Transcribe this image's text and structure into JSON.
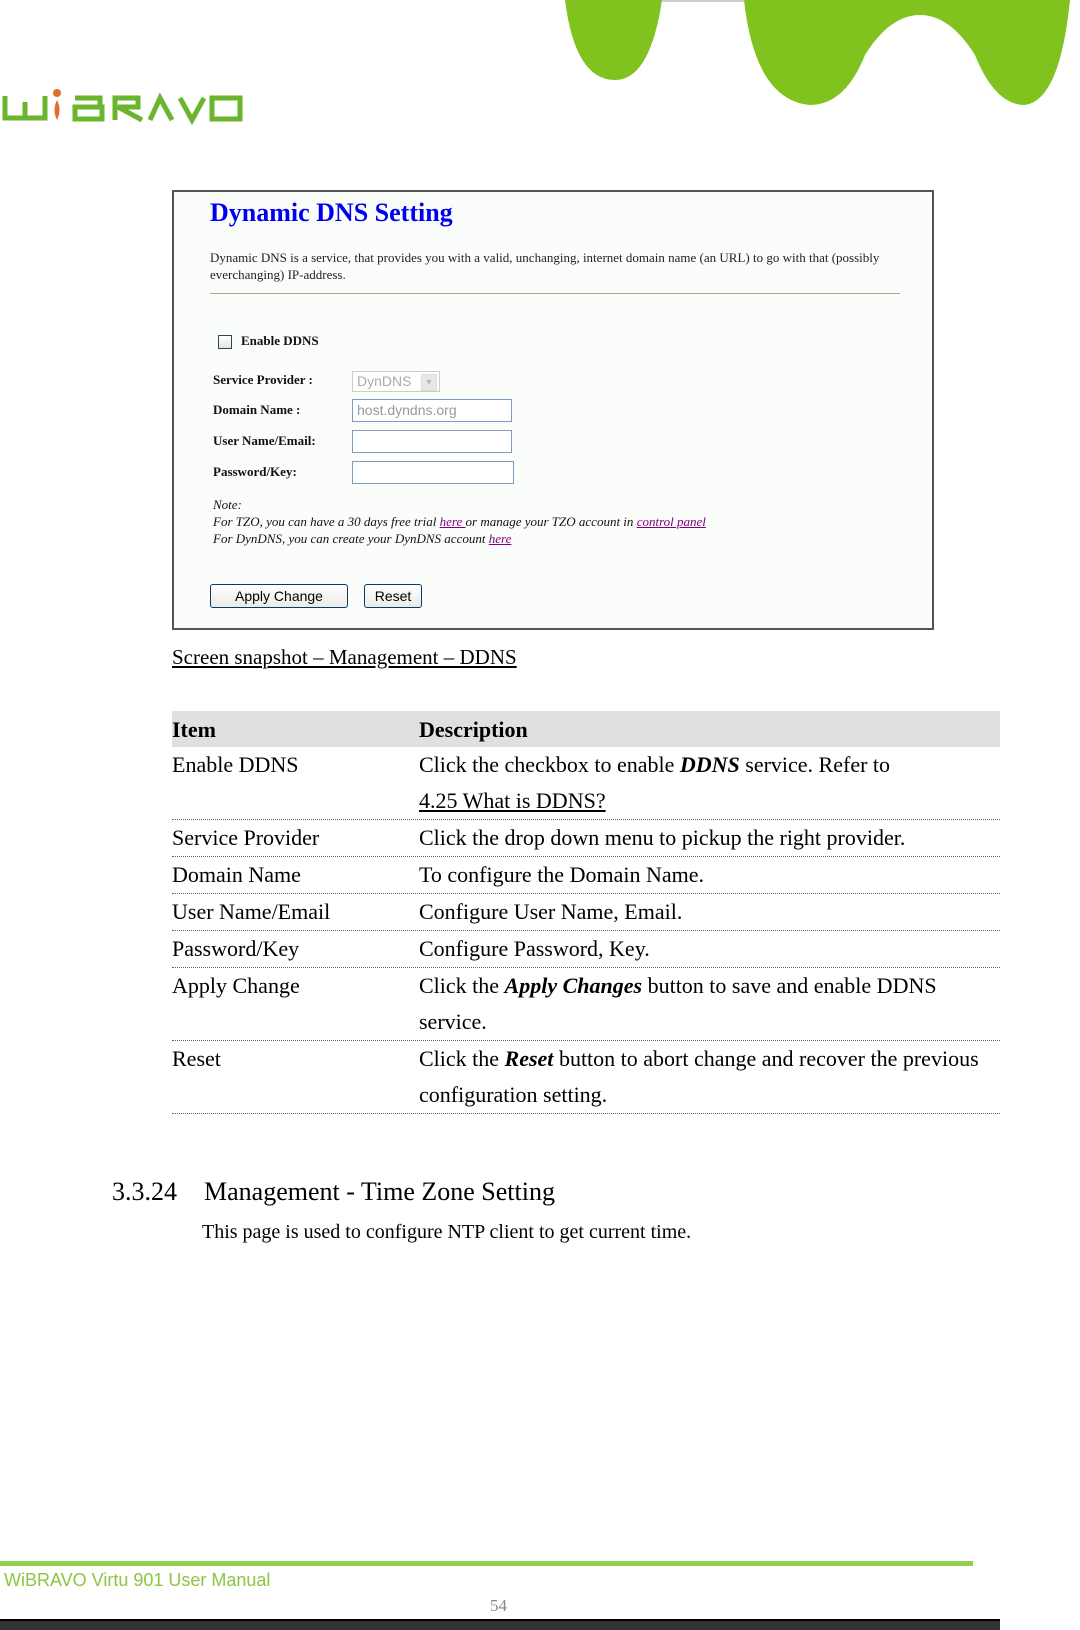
{
  "header": {
    "logo_text": "WiBRAVO",
    "brand_color": "#8cc63f",
    "accent_dot_color": "#e8692c"
  },
  "snapshot": {
    "title": "Dynamic DNS  Setting",
    "intro": "Dynamic DNS is a service, that provides you with a valid, unchanging, internet domain name (an URL) to go with that (possibly everchanging) IP-address.",
    "enable_label": "Enable DDNS",
    "enable_checked": false,
    "fields": {
      "service_provider_label": "Service Provider :",
      "service_provider_value": "DynDNS",
      "domain_name_label": "Domain Name :",
      "domain_name_value": "host.dyndns.org",
      "user_label": "User Name/Email:",
      "user_value": "",
      "password_label": "Password/Key:",
      "password_value": ""
    },
    "note": {
      "heading": "Note:",
      "line1_pre": "For TZO, you can have a 30 days free trial ",
      "line1_link1": "here ",
      "line1_mid": "or manage your TZO account in ",
      "line1_link2": "control panel",
      "line2_pre": "For DynDNS, you can create your DynDNS account ",
      "line2_link": "here"
    },
    "apply_button": "Apply Change",
    "reset_button": "Reset"
  },
  "caption": "Screen snapshot – Management – DDNS",
  "table": {
    "headers": [
      "Item",
      "Description"
    ],
    "rows": [
      {
        "item": "Enable DDNS",
        "d1": "Click the checkbox to enable ",
        "bold": "DDNS",
        "d2": " service. Refer to ",
        "link": "4.25 What is DDNS?"
      },
      {
        "item": "Service Provider",
        "desc": "Click the drop down menu to pickup the right provider."
      },
      {
        "item": "Domain Name",
        "desc": "To configure the Domain Name."
      },
      {
        "item": "User Name/Email",
        "desc": "Configure User Name, Email."
      },
      {
        "item": "Password/Key",
        "desc": "Configure Password, Key."
      },
      {
        "item": "Apply Change",
        "d1": "Click the ",
        "bold": "Apply Changes",
        "d2": " button to save and enable DDNS service."
      },
      {
        "item": "Reset",
        "d1": "Click the ",
        "bold": "Reset",
        "d2": " button to abort change and recover the previous configuration setting."
      }
    ]
  },
  "section": {
    "number": "3.3.24",
    "title": "Management - Time Zone Setting",
    "description": "This page is used to configure NTP client to get current time."
  },
  "footer": {
    "manual_title": "WiBRAVO Virtu 901 User Manual",
    "page_number": "54"
  }
}
